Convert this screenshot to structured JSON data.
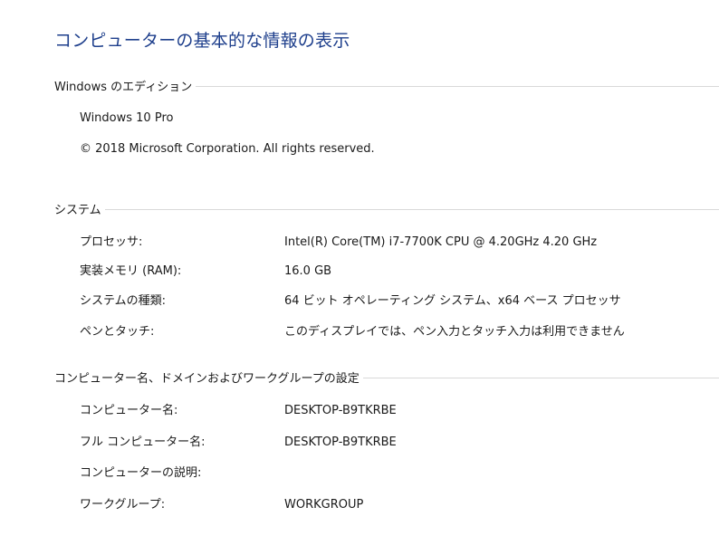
{
  "page": {
    "title": "コンピューターの基本的な情報の表示",
    "title_color": "#1e3f8c"
  },
  "edition": {
    "header": "Windows のエディション",
    "name": "Windows 10 Pro",
    "copyright": "© 2018 Microsoft Corporation. All rights reserved."
  },
  "system": {
    "header": "システム",
    "rows": [
      {
        "label": "プロセッサ:",
        "value": "Intel(R) Core(TM) i7-7700K CPU @ 4.20GHz   4.20 GHz"
      },
      {
        "label": "実装メモリ (RAM):",
        "value": "16.0 GB"
      },
      {
        "label": "システムの種類:",
        "value": "64 ビット オペレーティング システム、x64 ベース プロセッサ"
      },
      {
        "label": "ペンとタッチ:",
        "value": "このディスプレイでは、ペン入力とタッチ入力は利用できません"
      }
    ]
  },
  "computer": {
    "header": "コンピューター名、ドメインおよびワークグループの設定",
    "rows": [
      {
        "label": "コンピューター名:",
        "value": "DESKTOP-B9TKRBE"
      },
      {
        "label": "フル コンピューター名:",
        "value": "DESKTOP-B9TKRBE"
      },
      {
        "label": "コンピューターの説明:",
        "value": ""
      },
      {
        "label": "ワークグループ:",
        "value": "WORKGROUP"
      }
    ]
  }
}
